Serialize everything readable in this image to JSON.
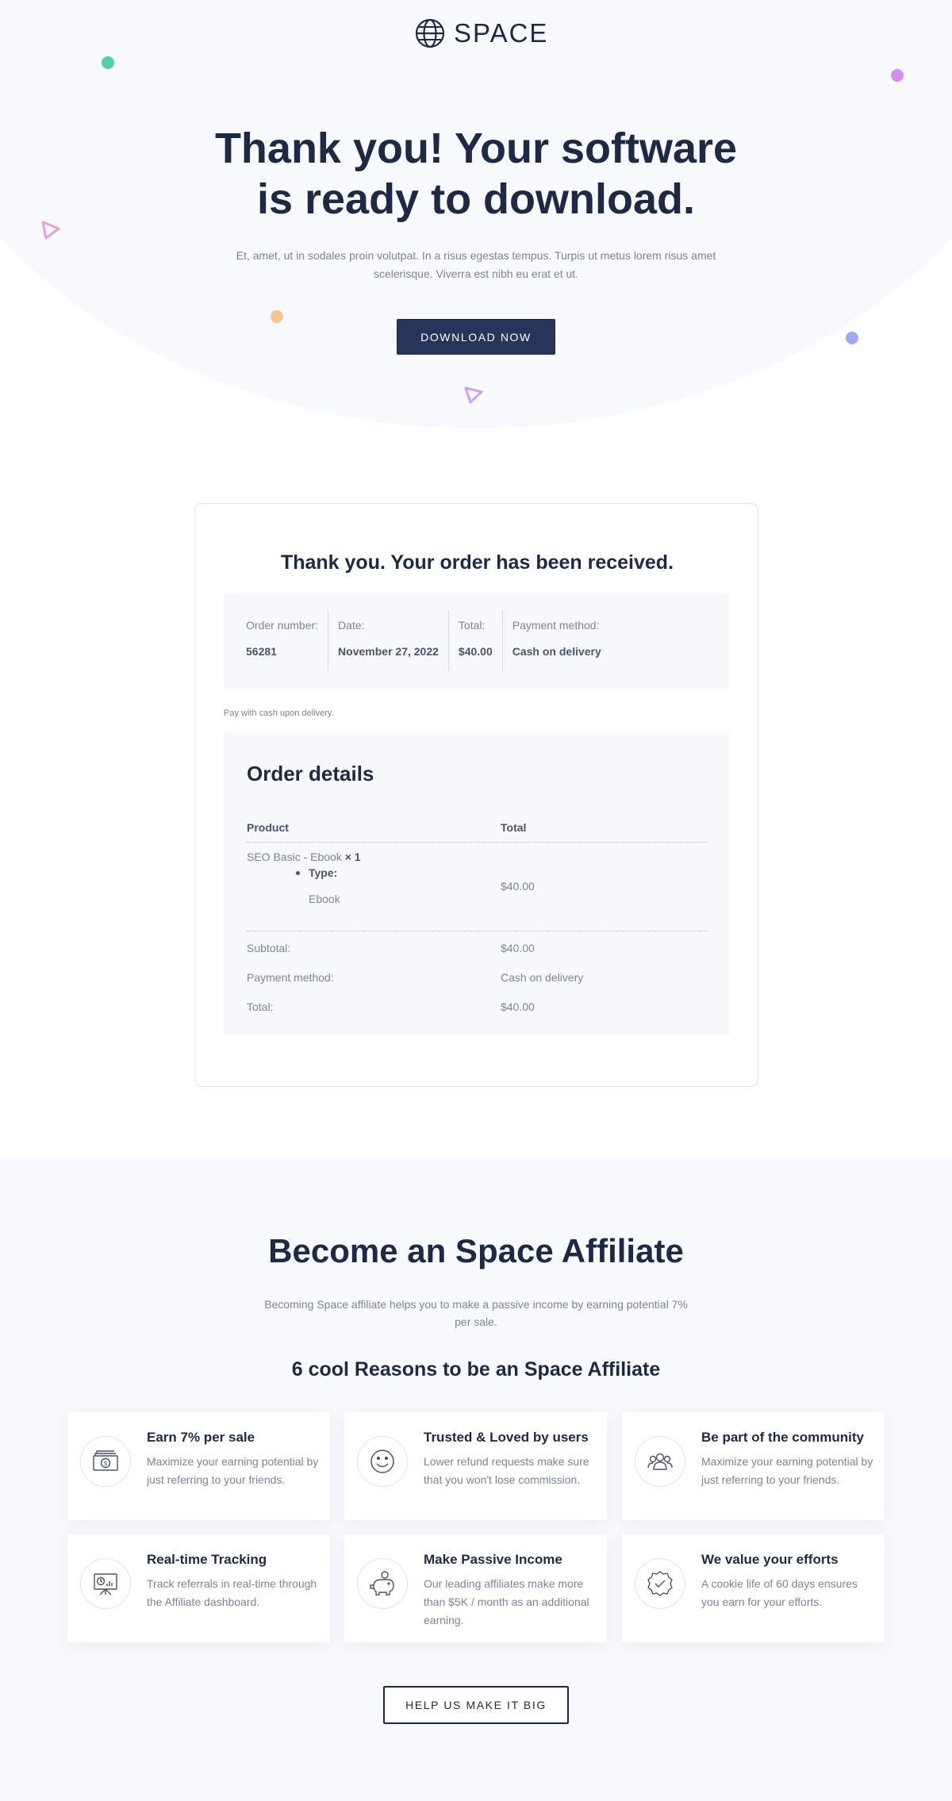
{
  "brand": {
    "name": "SPACE",
    "icon": "globe-icon"
  },
  "hero": {
    "title_line1": "Thank you! Your software",
    "title_line2": "is ready to download.",
    "subtitle": "Et, amet, ut in sodales proin volutpat. In a risus egestas tempus. Turpis ut metus lorem risus amet scelerisque. Viverra est nibh eu erat et ut.",
    "button": "DOWNLOAD NOW"
  },
  "order": {
    "title": "Thank you. Your order has been received.",
    "overview": [
      {
        "label": "Order number:",
        "value": "56281"
      },
      {
        "label": "Date:",
        "value": "November 27, 2022"
      },
      {
        "label": "Total:",
        "value": "$40.00"
      },
      {
        "label": "Payment method:",
        "value": "Cash on delivery"
      }
    ],
    "payment_note": "Pay with cash upon delivery.",
    "details": {
      "title": "Order details",
      "col_product": "Product",
      "col_total": "Total",
      "item_name": "SEO Basic - Ebook",
      "item_qty": "× 1",
      "item_meta_key": "Type:",
      "item_meta_value": "Ebook",
      "item_total": "$40.00",
      "subtotal_label": "Subtotal:",
      "subtotal_value": "$40.00",
      "payment_label": "Payment method:",
      "payment_value": "Cash on delivery",
      "total_label": "Total:",
      "total_value": "$40.00"
    }
  },
  "affiliate": {
    "title": "Become an Space Affiliate",
    "subtitle": "Becoming Space affiliate helps you to make a passive income by earning potential 7% per sale.",
    "reasons_title": "6 cool Reasons to be an Space Affiliate",
    "features": [
      {
        "title": "Earn 7% per sale",
        "desc": "Maximize your earning potential by just referring to your friends.",
        "icon": "money-icon"
      },
      {
        "title": "Trusted & Loved by users",
        "desc": "Lower refund requests make sure that you won't lose commission.",
        "icon": "smiley-icon"
      },
      {
        "title": "Be part of the community",
        "desc": "Maximize your earning potential by just referring to your friends.",
        "icon": "community-icon"
      },
      {
        "title": "Real-time Tracking",
        "desc": "Track referrals in real-time through the Affiliate dashboard.",
        "icon": "tracking-board-icon"
      },
      {
        "title": "Make Passive Income",
        "desc": "Our leading affiliates make more than $5K / month as an additional earning.",
        "icon": "piggy-bank-icon"
      },
      {
        "title": "We value your efforts",
        "desc": "A cookie life of 60 days ensures you earn for your efforts.",
        "icon": "badge-check-icon"
      }
    ],
    "button": "HELP US MAKE IT BIG"
  },
  "colors": {
    "primary": "#1e2a45",
    "button_dark": "#263559",
    "muted_text": "#7b8499",
    "hero_bg": "#f7f9fd",
    "dot_teal": "#4fd1a9",
    "dot_purple": "#d48cf0",
    "dot_orange": "#fbc38f",
    "dot_blue": "#9daaf2",
    "triangle_pink": "#f29be0",
    "triangle_purple": "#d1a1f2"
  }
}
